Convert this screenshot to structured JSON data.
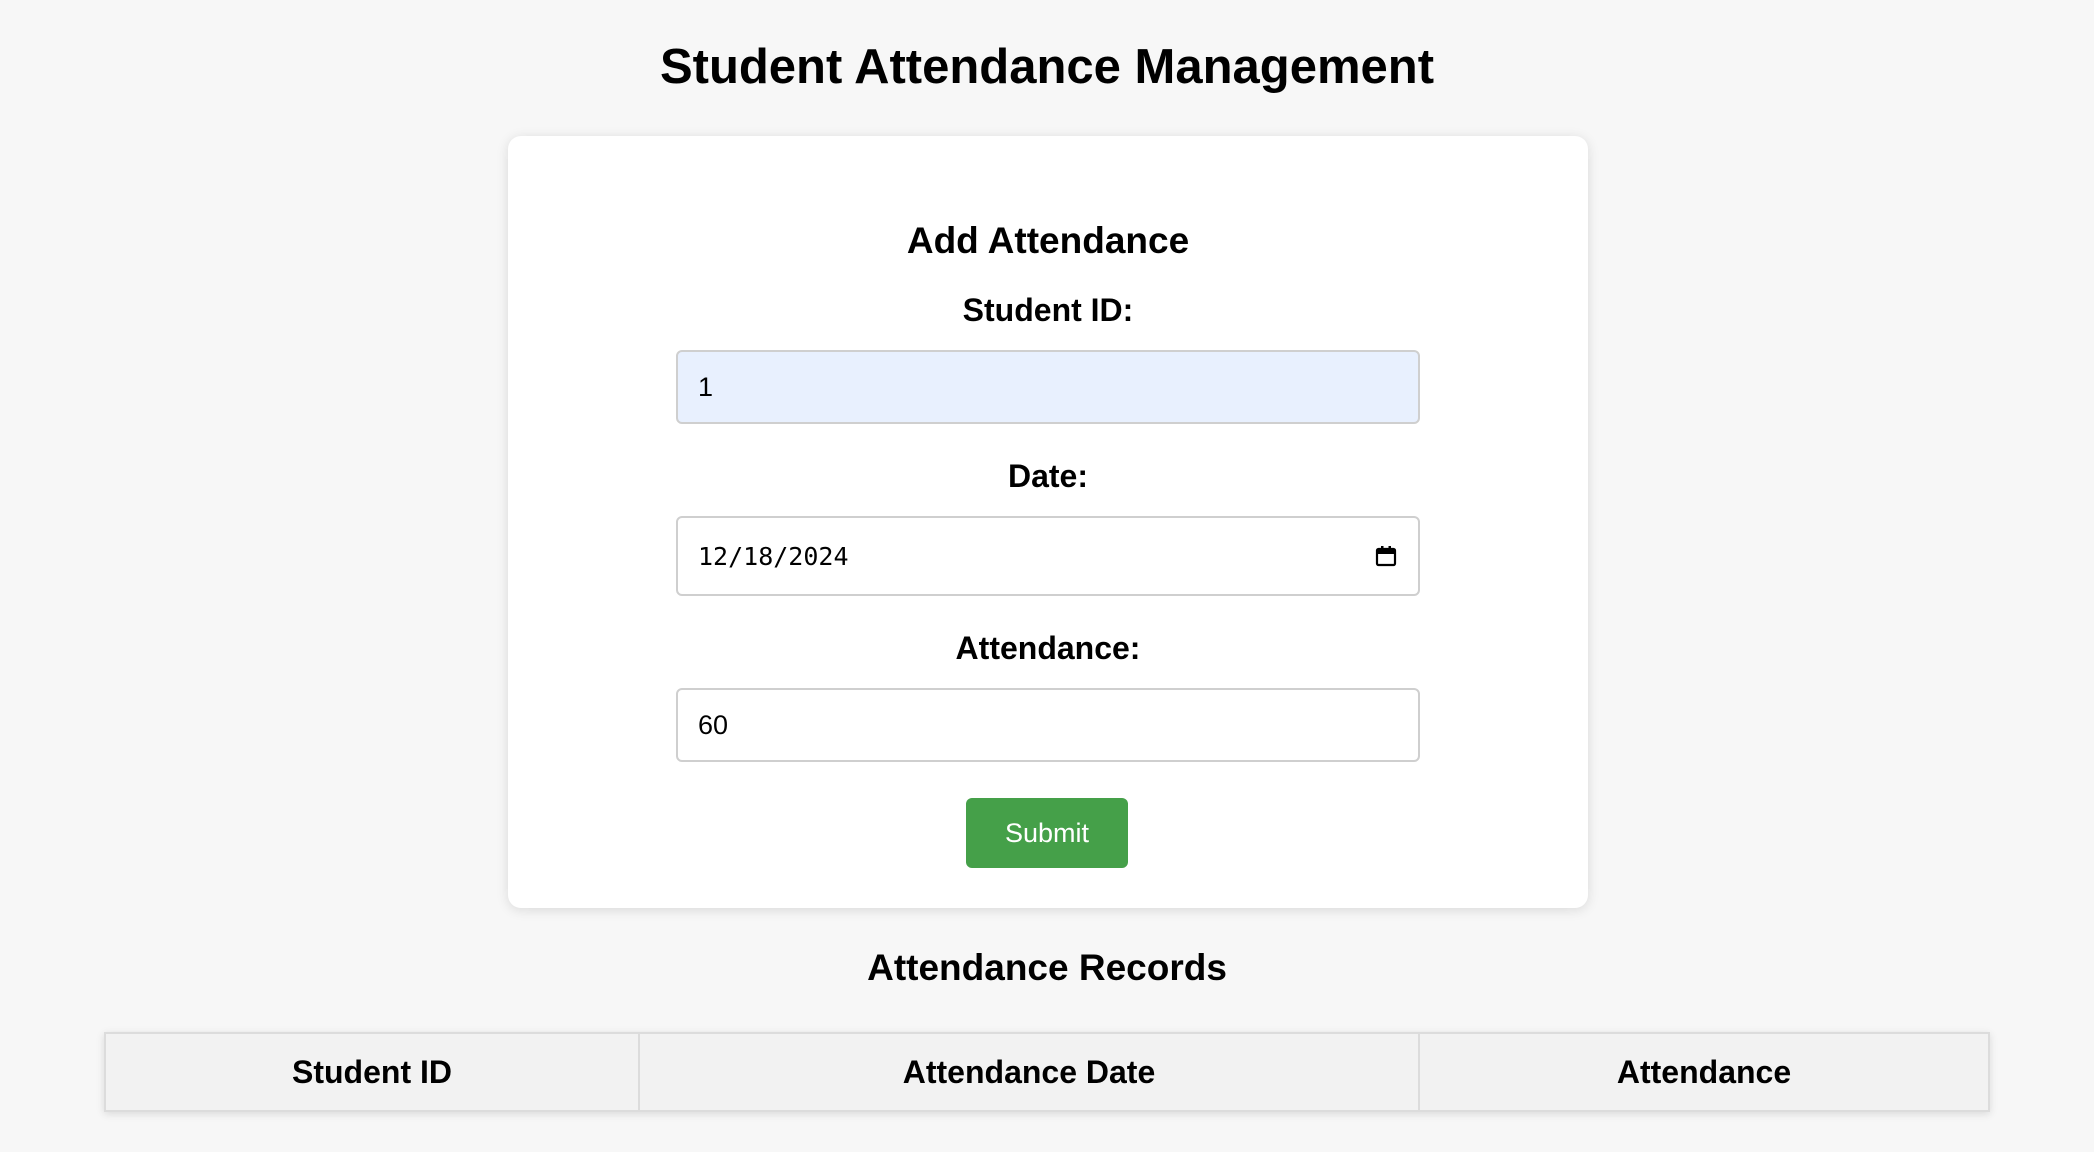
{
  "page": {
    "title": "Student Attendance Management"
  },
  "form": {
    "title": "Add Attendance",
    "student_id": {
      "label": "Student ID:",
      "value": "1"
    },
    "date": {
      "label": "Date:",
      "value": "12/18/2024",
      "icon": "calendar-icon"
    },
    "attendance": {
      "label": "Attendance:",
      "value": "60"
    },
    "submit_label": "Submit",
    "submit_color": "#45a049",
    "autofill_color": "#e8f0fe"
  },
  "records": {
    "title": "Attendance Records",
    "columns": [
      "Student ID",
      "Attendance Date",
      "Attendance"
    ],
    "rows": []
  }
}
